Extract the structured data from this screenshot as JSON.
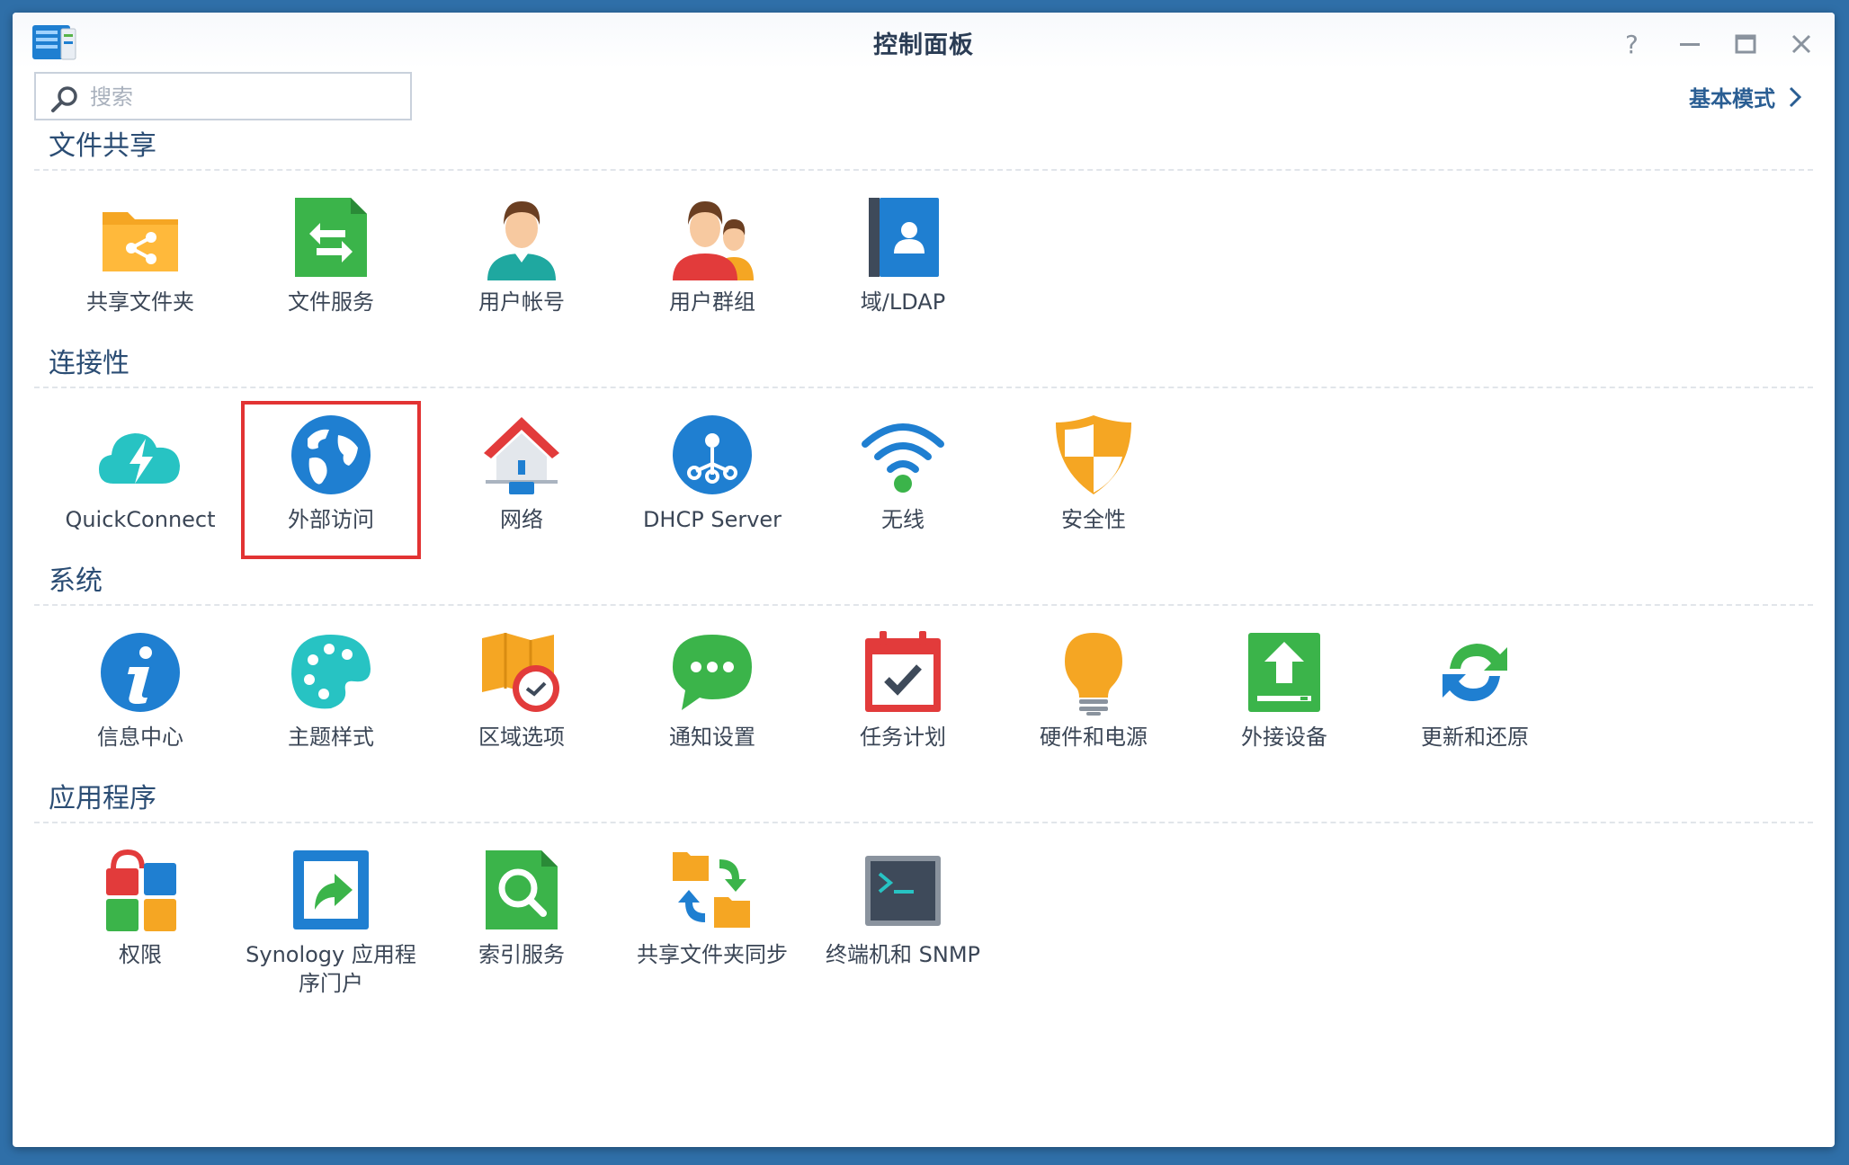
{
  "window": {
    "title": "控制面板",
    "help_label": "?",
    "search_placeholder": "搜索",
    "mode_link": "基本模式"
  },
  "sections": [
    {
      "title": "文件共享",
      "items": [
        {
          "label": "共享文件夹",
          "icon": "shared-folder-icon"
        },
        {
          "label": "文件服务",
          "icon": "file-services-icon"
        },
        {
          "label": "用户帐号",
          "icon": "user-icon"
        },
        {
          "label": "用户群组",
          "icon": "group-icon"
        },
        {
          "label": "域/LDAP",
          "icon": "domain-ldap-icon"
        }
      ]
    },
    {
      "title": "连接性",
      "items": [
        {
          "label": "QuickConnect",
          "icon": "quickconnect-icon"
        },
        {
          "label": "外部访问",
          "icon": "globe-icon",
          "selected": true
        },
        {
          "label": "网络",
          "icon": "network-icon"
        },
        {
          "label": "DHCP Server",
          "icon": "dhcp-icon"
        },
        {
          "label": "无线",
          "icon": "wifi-icon"
        },
        {
          "label": "安全性",
          "icon": "shield-icon"
        }
      ]
    },
    {
      "title": "系统",
      "items": [
        {
          "label": "信息中心",
          "icon": "info-icon"
        },
        {
          "label": "主题样式",
          "icon": "palette-icon"
        },
        {
          "label": "区域选项",
          "icon": "regional-map-clock-icon"
        },
        {
          "label": "通知设置",
          "icon": "chat-bubble-icon"
        },
        {
          "label": "任务计划",
          "icon": "calendar-check-icon"
        },
        {
          "label": "硬件和电源",
          "icon": "lightbulb-icon"
        },
        {
          "label": "外接设备",
          "icon": "upload-device-icon"
        },
        {
          "label": "更新和还原",
          "icon": "refresh-icon"
        }
      ]
    },
    {
      "title": "应用程序",
      "items": [
        {
          "label": "权限",
          "icon": "privileges-icon"
        },
        {
          "label": "Synology 应用程序门户",
          "label_line1": "Synology 应用程",
          "label_line2": "序门户",
          "icon": "app-portal-icon"
        },
        {
          "label": "索引服务",
          "icon": "index-search-icon"
        },
        {
          "label": "共享文件夹同步",
          "icon": "folder-sync-icon"
        },
        {
          "label": "终端机和 SNMP",
          "icon": "terminal-icon"
        }
      ]
    }
  ],
  "colors": {
    "accent": "#2a5e93",
    "selection": "#e23333",
    "section_title": "#2b4d74"
  }
}
